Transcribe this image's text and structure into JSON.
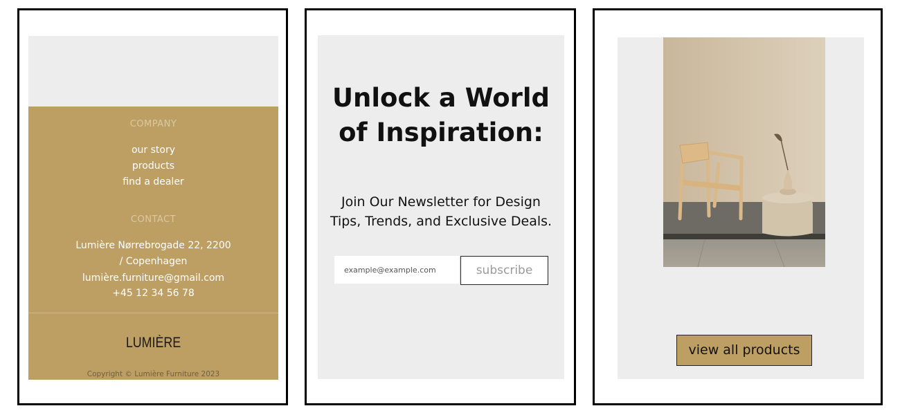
{
  "panel1": {
    "company_heading": "COMPANY",
    "company_links": [
      "our story",
      "products",
      "find a dealer"
    ],
    "contact_heading": "CONTACT",
    "contact_lines": [
      "Lumière Nørrebrogade 22, 2200",
      "/ Copenhagen",
      "lumière.furniture@gmail.com",
      "+45 12 34 56 78"
    ],
    "logo": "LUMIÈRE",
    "copyright": "Copyright © Lumière Furniture 2023"
  },
  "panel2": {
    "heading_line1": "Unlock a World",
    "heading_line2": "of Inspiration:",
    "subtext_line1": "Join Our Newsletter for Design",
    "subtext_line2": "Tips, Trends, and Exclusive Deals.",
    "email_placeholder": "example@example.com",
    "subscribe_label": "subscribe"
  },
  "panel3": {
    "view_all_label": "view all products"
  },
  "colors": {
    "gold": "#bd9f64",
    "panel_bg": "#ededed"
  }
}
